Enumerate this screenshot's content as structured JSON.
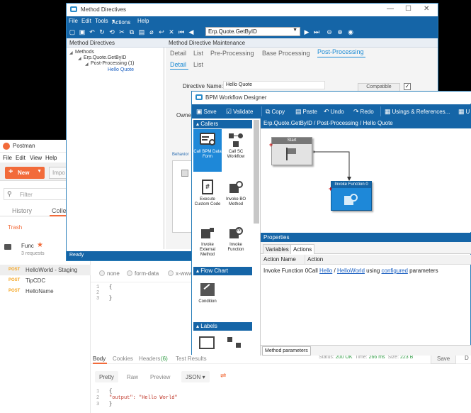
{
  "postman": {
    "title": "Postman",
    "menu": [
      "File",
      "Edit",
      "View",
      "Help"
    ],
    "new_label": "New",
    "import_label": "Impo",
    "filter_placeholder": "Filter",
    "tab_history": "History",
    "tab_collections": "Colle",
    "trash": "Trash",
    "collection_name": "Func",
    "collection_count": "3 requests",
    "requests": [
      {
        "method": "POST",
        "name": "HelloWorld - Staging"
      },
      {
        "method": "POST",
        "name": "TipCDC"
      },
      {
        "method": "POST",
        "name": "HelloName"
      }
    ],
    "body_options": [
      "none",
      "form-data",
      "x-www-"
    ],
    "editor_lines": [
      {
        "num": "1",
        "text": "{"
      },
      {
        "num": "2",
        "text": ""
      },
      {
        "num": "3",
        "text": "}"
      }
    ],
    "response_tabs": [
      "Body",
      "Cookies",
      "Headers",
      "(6)",
      "Test Results"
    ],
    "status_label": "Status:",
    "status_value": "200 OK",
    "time_label": "Time:",
    "time_value": "266 ms",
    "size_label": "Size:",
    "size_value": "223 B",
    "save_label": "Save",
    "d_label": "D",
    "resp_formats": [
      "Pretty",
      "Raw",
      "Preview",
      "JSON"
    ],
    "output_lines": [
      {
        "num": "1",
        "text": "{"
      },
      {
        "num": "2",
        "text": "    \"output\": \"Hello World\""
      },
      {
        "num": "3",
        "text": "}"
      }
    ]
  },
  "method_directives": {
    "title": "Method Directives",
    "menu": [
      "File",
      "Edit",
      "Tools",
      "Actions",
      "Help"
    ],
    "combo_value": "Erp.Quote.GetByID",
    "left_header": "Method Directives",
    "right_header": "Method Directive Maintenance",
    "tree": [
      "Methods",
      "Erp.Quote.GetByID",
      "Post-Processing (1)",
      "Hello Quote"
    ],
    "tabs": [
      "Detail",
      "List",
      "Pre-Processing",
      "Base Processing",
      "Post-Processing"
    ],
    "subtabs": [
      "Detail",
      "List"
    ],
    "directive_name_label": "Directive Name:",
    "directive_name_value": "Hello Quote",
    "compatible_label": "Compatible",
    "owner_label": "Owne",
    "behavior_label": "Behavior",
    "status": "Ready"
  },
  "bpm": {
    "title": "BPM Workflow Designer",
    "toolbar": [
      "Save",
      "Validate",
      "Copy",
      "Paste",
      "Undo",
      "Redo",
      "Usings & References...",
      "U"
    ],
    "palette_callers": "Callers",
    "palette_items": [
      {
        "label": "Call BPM Data Form",
        "icon": "form-icon"
      },
      {
        "label": "Call SC Workflow",
        "icon": "workflow-icon"
      },
      {
        "label": "Execute Custom Code",
        "icon": "code-icon"
      },
      {
        "label": "Invoke BO Method",
        "icon": "bo-method-icon"
      },
      {
        "label": "Invoke External Method",
        "icon": "external-method-icon"
      },
      {
        "label": "Invoke Function",
        "icon": "function-icon"
      }
    ],
    "palette_flowchart": "Flow Chart",
    "flow_items": [
      {
        "label": "Condition",
        "icon": "condition-icon"
      }
    ],
    "palette_labels": "Labels",
    "breadcrumb": "Erp.Quote.GetByID / Post-Processing / Hello Quote",
    "node_start": "Start",
    "node_invoke": "Invoke Function 0",
    "properties_header": "Properties",
    "props_tabs": [
      "Variables",
      "Actions"
    ],
    "grid_headers": [
      "Action Name",
      "Action"
    ],
    "grid_row": {
      "name": "Invoke Function 0",
      "call": "Call",
      "hello": "Hello",
      "slash": "/",
      "helloworld": "HelloWorld",
      "using": "using",
      "configured": "configured",
      "parameters": "parameters"
    },
    "bottom_tab": "Method parameters"
  },
  "colors": {
    "epicor_blue": "#1565a7",
    "accent_blue": "#1e88d8",
    "postman_orange": "#f26b3a"
  }
}
